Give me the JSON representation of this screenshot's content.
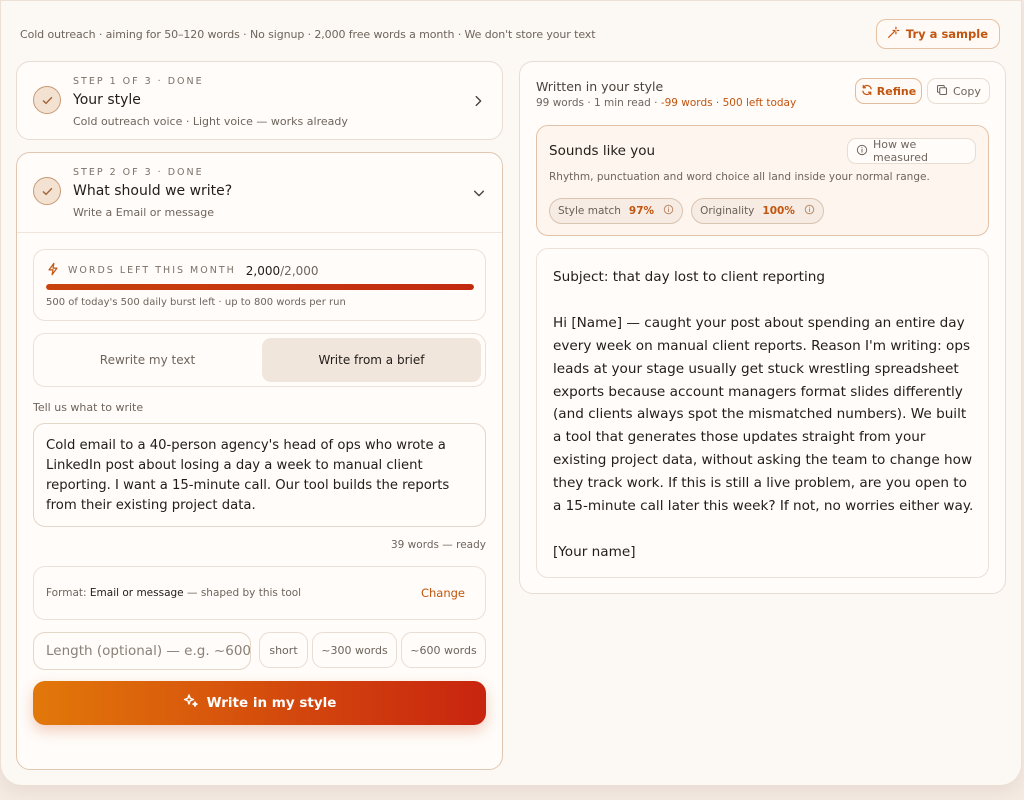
{
  "topbar": {
    "info": "Cold outreach · aiming for 50–120 words · No signup · 2,000 free words a month · We don't store your text",
    "sample_label": "Try a sample"
  },
  "step1": {
    "eyebrow": "STEP 1 OF 3 · DONE",
    "title": "Your style",
    "subtitle": "Cold outreach voice · Light voice — works already"
  },
  "step2": {
    "eyebrow": "STEP 2 OF 3 · DONE",
    "title": "What should we write?",
    "subtitle": "Write a Email or message",
    "quota": {
      "label": "WORDS LEFT THIS MONTH",
      "used": "2,000",
      "total": "/2,000",
      "fraction": 1.0,
      "note": "500 of today's 500 daily burst left · up to 800 words per run"
    },
    "modes": {
      "rewrite": "Rewrite my text",
      "brief": "Write from a brief",
      "selected": "brief"
    },
    "brief_label": "Tell us what to write",
    "brief_text": "Cold email to a 40-person agency's head of ops who wrote a LinkedIn post about losing a day a week to manual client reporting. I want a 15-minute call. Our tool builds the reports from their existing project data.",
    "word_count": "39 words — ready",
    "format": {
      "prefix": "Format: ",
      "value": "Email or message",
      "suffix": " — shaped by this tool",
      "change_label": "Change"
    },
    "length_placeholder": "Length (optional) — e.g. ~600",
    "length_chips": [
      "short",
      "~300 words",
      "~600 words"
    ],
    "submit_label": "Write in my style"
  },
  "output": {
    "title": "Written in your style",
    "meta": {
      "words": "99 words",
      "read": " · 1 min read · ",
      "delta": "-99 words",
      "sep": " · ",
      "left": "500 left today"
    },
    "refine_label": "Refine",
    "copy_label": "Copy",
    "sounds": {
      "title": "Sounds like you",
      "how_label": "How we measured",
      "desc": "Rhythm, punctuation and word choice all land inside your normal range.",
      "style_label": "Style match",
      "style_value": "97%",
      "orig_label": "Originality",
      "orig_value": "100%"
    },
    "email": {
      "subject": "Subject: that day lost to client reporting",
      "body": "Hi [Name] — caught your post about spending an entire day every week on manual client reports. Reason I'm writing: ops leads at your stage usually get stuck wrestling spreadsheet exports because account managers format slides differently (and clients always spot the mismatched numbers). We built a tool that generates those updates straight from your existing project data, without asking the team to change how they track work. If this is still a live problem, are you open to a 15-minute call later this week? If not, no worries either way.",
      "signoff": "[Your name]"
    }
  },
  "colors": {
    "accent": "#c2550f",
    "gradient_start": "#e2780a",
    "gradient_end": "#c8240f",
    "background": "#fcf8f4"
  }
}
